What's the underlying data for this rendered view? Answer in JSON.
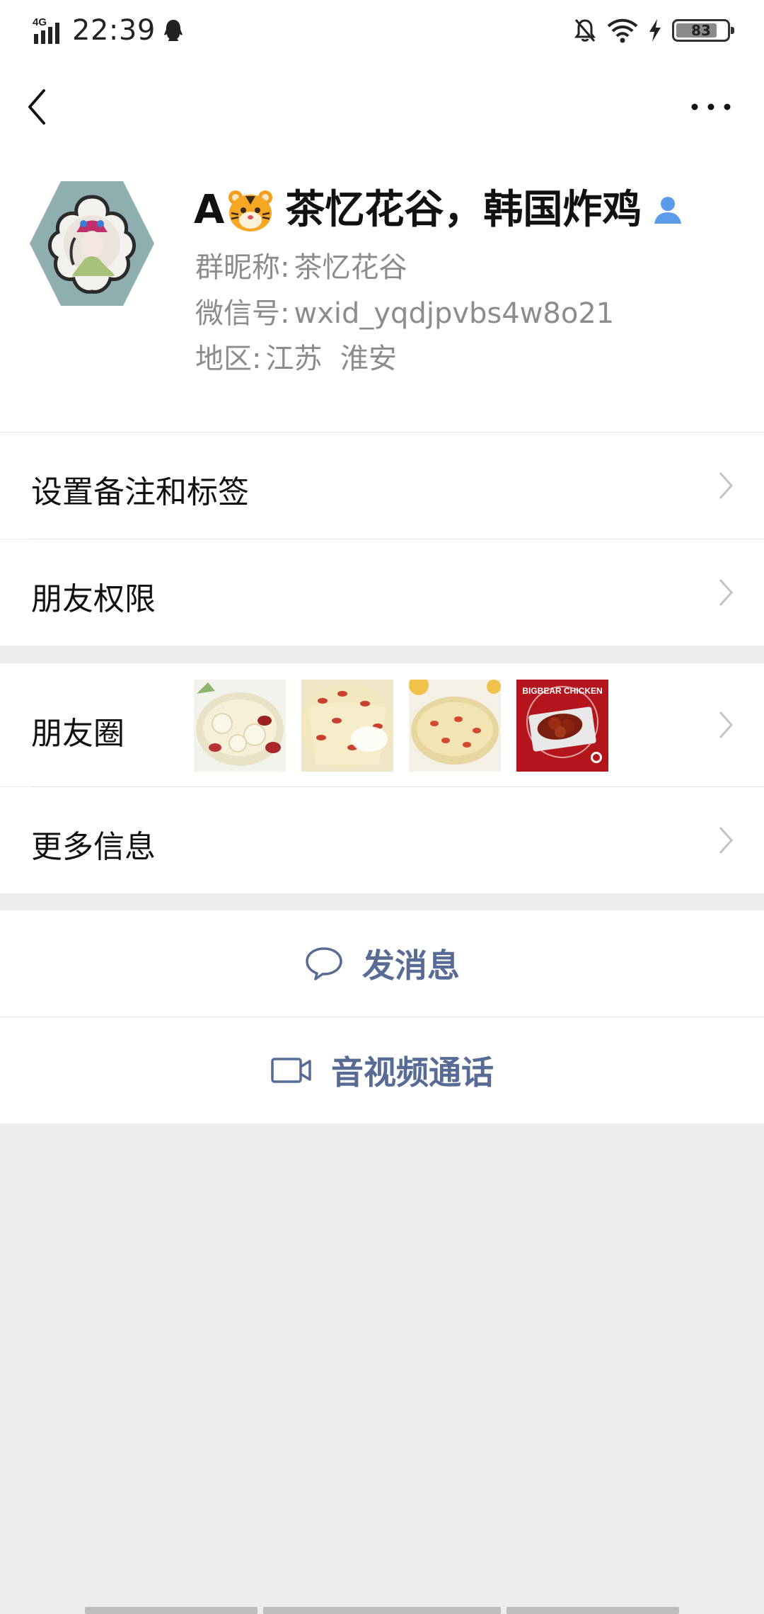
{
  "status_bar": {
    "network": "4G",
    "time": "22:39",
    "battery_level": "83"
  },
  "profile": {
    "name_prefix": "A",
    "name_suffix": "茶忆花谷，韩国炸鸡",
    "group_nickname_label": "群昵称:",
    "group_nickname": "茶忆花谷",
    "wechat_id_label": "微信号:",
    "wechat_id": "wxid_yqdjpvbs4w8o21",
    "region_label": "地区:",
    "region": "江苏  淮安"
  },
  "list": {
    "remark_tags": "设置备注和标签",
    "friend_permissions": "朋友权限",
    "moments": "朋友圈",
    "more_info": "更多信息"
  },
  "actions": {
    "send_message": "发消息",
    "av_call": "音视频通话"
  },
  "thumb_4_text": "BIGBEAR CHICKEN",
  "colors": {
    "link_blue": "#576b95",
    "background": "#ededed",
    "verified_icon": "#5b9bea"
  }
}
